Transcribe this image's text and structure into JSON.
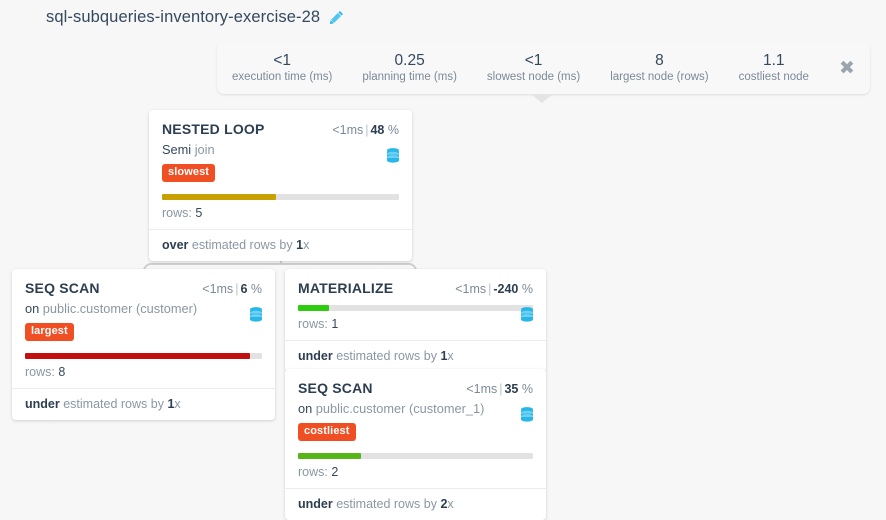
{
  "header": {
    "title": "sql-subqueries-inventory-exercise-28",
    "edit_icon": "pencil-icon"
  },
  "stats": {
    "close_label": "✖",
    "items": [
      {
        "value": "<1",
        "label": "execution time (ms)"
      },
      {
        "value": "0.25",
        "label": "planning time (ms)"
      },
      {
        "value": "<1",
        "label": "slowest node (ms)"
      },
      {
        "value": "8",
        "label": "largest node (rows)"
      },
      {
        "value": "1.1",
        "label": "costliest node"
      }
    ]
  },
  "colors": {
    "badge": "#f04e23",
    "bar_slowest": "#c8a000",
    "bar_largest": "#c40d0d",
    "bar_green_bright": "#2ecc0f",
    "bar_green": "#58b518",
    "db_icon": "#29b6e8",
    "pencil": "#29b6e8",
    "track": "#e2e2e2",
    "connector": "#cfcfcf"
  },
  "nodes": {
    "nested_loop": {
      "type": "NESTED LOOP",
      "time": "<1ms",
      "separator": "|",
      "percent": "48",
      "percent_unit": "%",
      "subject_prefix": "Semi",
      "subject": "join",
      "badges": [
        "slowest"
      ],
      "bar_percent": 48,
      "bar_color": "#c8a000",
      "rows_label": "rows:",
      "rows_value": "5",
      "estimate_key": "over",
      "estimate_text": "estimated rows by",
      "estimate_factor": "1",
      "estimate_suffix": "x",
      "db_icon": "database-icon"
    },
    "seq_scan_left": {
      "type": "SEQ SCAN",
      "time": "<1ms",
      "separator": "|",
      "percent": "6",
      "percent_unit": "%",
      "subject_prefix": "on",
      "subject": "public.customer (customer)",
      "badges": [
        "largest"
      ],
      "bar_percent": 95,
      "bar_color": "#c40d0d",
      "rows_label": "rows:",
      "rows_value": "8",
      "estimate_key": "under",
      "estimate_text": "estimated rows by",
      "estimate_factor": "1",
      "estimate_suffix": "x",
      "db_icon": "database-icon"
    },
    "materialize": {
      "type": "MATERIALIZE",
      "time": "<1ms",
      "separator": "|",
      "percent": "-240",
      "percent_unit": "%",
      "subject_prefix": "",
      "subject": "",
      "badges": [],
      "bar_percent": 13,
      "bar_color": "#2ecc0f",
      "rows_label": "rows:",
      "rows_value": "1",
      "estimate_key": "under",
      "estimate_text": "estimated rows by",
      "estimate_factor": "1",
      "estimate_suffix": "x",
      "db_icon": "database-icon"
    },
    "seq_scan_bottom": {
      "type": "SEQ SCAN",
      "time": "<1ms",
      "separator": "|",
      "percent": "35",
      "percent_unit": "%",
      "subject_prefix": "on",
      "subject": "public.customer (customer_1)",
      "badges": [
        "costliest"
      ],
      "bar_percent": 27,
      "bar_color": "#58b518",
      "rows_label": "rows:",
      "rows_value": "2",
      "estimate_key": "under",
      "estimate_text": "estimated rows by",
      "estimate_factor": "2",
      "estimate_suffix": "x",
      "db_icon": "database-icon"
    }
  }
}
